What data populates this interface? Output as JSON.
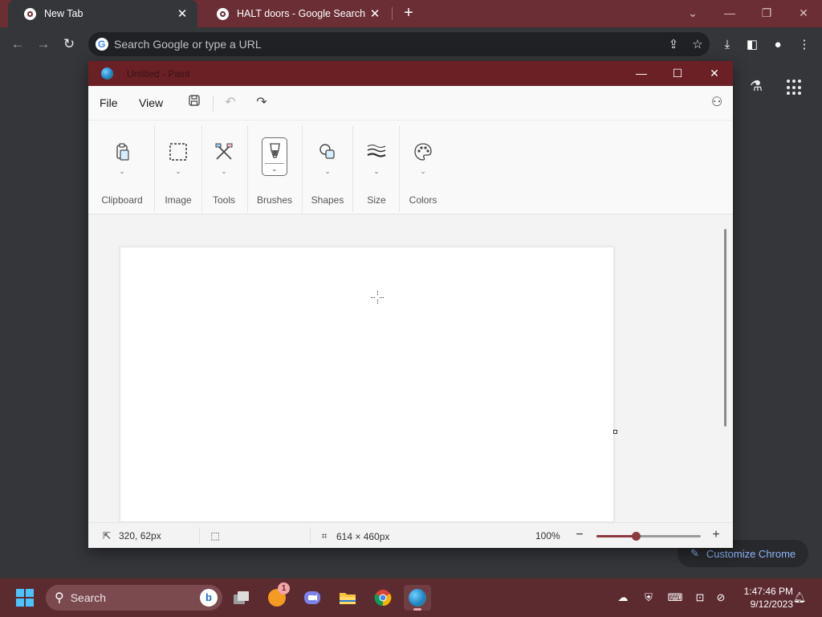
{
  "chrome": {
    "tabs": [
      {
        "title": "New Tab",
        "active": true
      },
      {
        "title": "HALT doors - Google Search",
        "active": false
      }
    ],
    "omnibox_placeholder": "Search Google or type a URL",
    "customize_label": "Customize Chrome"
  },
  "paint": {
    "title": "Untitled - Paint",
    "menu": {
      "file": "File",
      "view": "View"
    },
    "ribbon_groups": [
      "Clipboard",
      "Image",
      "Tools",
      "Brushes",
      "Shapes",
      "Size",
      "Colors"
    ],
    "status": {
      "cursor_position": "320, 62px",
      "canvas_size": "614 × 460px",
      "zoom": "100%",
      "zoom_slider_fraction": 0.38
    }
  },
  "taskbar": {
    "search_placeholder": "Search",
    "notification_count": "1",
    "time": "1:47:46 PM",
    "date": "9/12/2023"
  },
  "colors": {
    "titlebar_accent": "#6b2026",
    "taskbar": "#5c2b30",
    "zoom_accent": "#8c3a3e",
    "link": "#8ab4f8"
  }
}
